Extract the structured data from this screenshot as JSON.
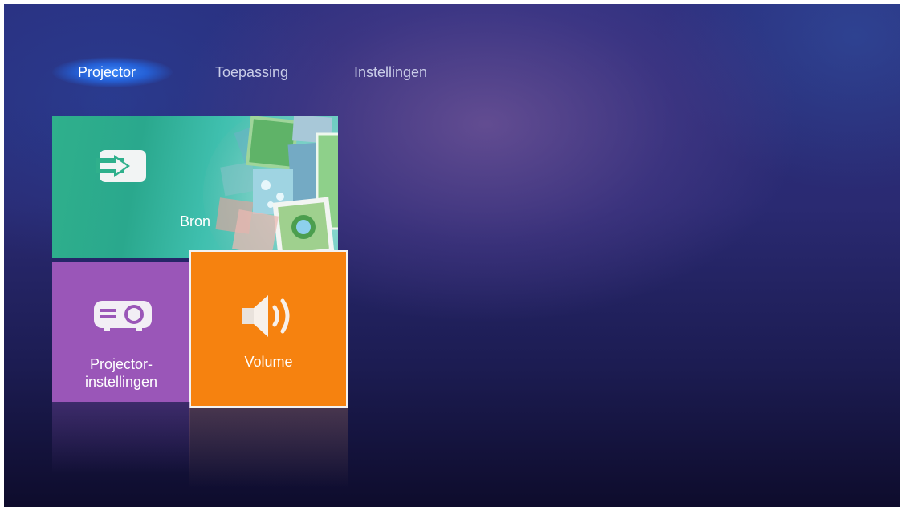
{
  "nav": {
    "tabs": [
      {
        "label": "Projector",
        "active": true
      },
      {
        "label": "Toepassing",
        "active": false
      },
      {
        "label": "Instellingen",
        "active": false
      }
    ]
  },
  "tiles": {
    "bron": {
      "label": "Bron",
      "icon": "input-source-icon",
      "color": "#2fb08c"
    },
    "projector_settings": {
      "label": "Projector-\ninstellingen",
      "icon": "projector-icon",
      "color": "#9a56b8"
    },
    "volume": {
      "label": "Volume",
      "icon": "speaker-icon",
      "color": "#f6820f",
      "selected": true
    }
  }
}
